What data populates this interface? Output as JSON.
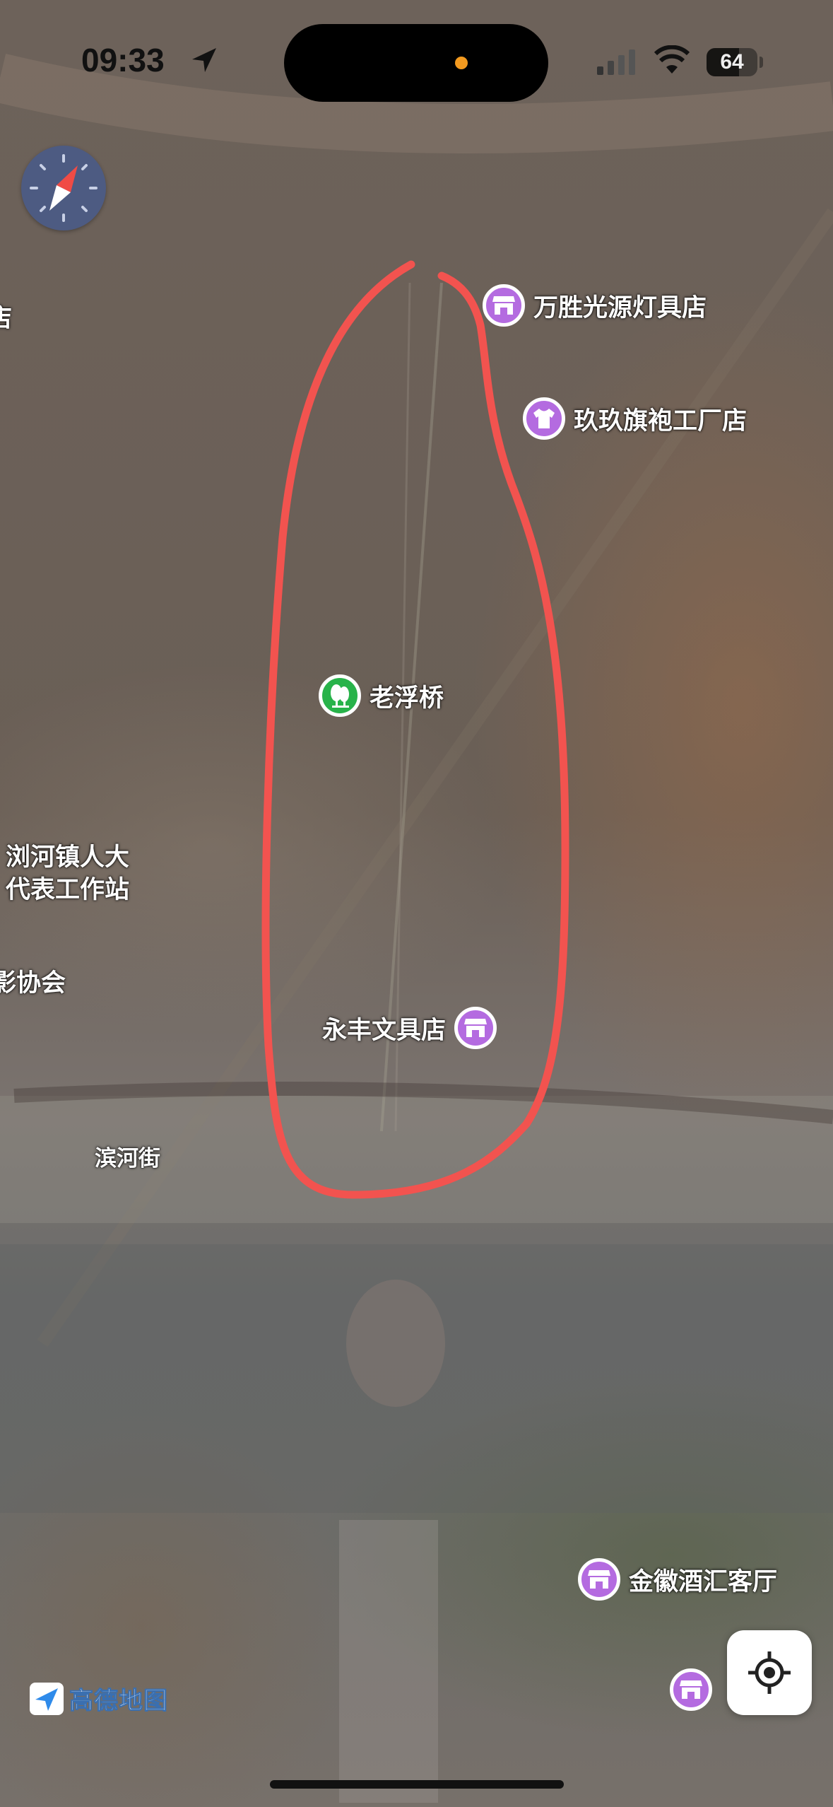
{
  "status_bar": {
    "time": "09:33",
    "battery": "64"
  },
  "map": {
    "compass_icon": "compass-icon",
    "pois": [
      {
        "label": "万胜光源灯具店",
        "icon": "shop-icon",
        "color": "#b46be0"
      },
      {
        "label": "玖玖旗袍工厂店",
        "icon": "clothing-icon",
        "color": "#b46be0"
      },
      {
        "label": "老浮桥",
        "icon": "park-icon",
        "color": "#28b34a"
      },
      {
        "label": "永丰文具店",
        "icon": "shop-icon",
        "color": "#b46be0"
      },
      {
        "label": "金徽酒汇客厅",
        "icon": "shop-icon",
        "color": "#b46be0"
      }
    ],
    "labels": {
      "edge_top": "店",
      "office_line1": "浏河镇人大",
      "office_line2": "代表工作站",
      "association": "影协会",
      "street": "滨河街"
    },
    "annotation_color": "#f2534f"
  },
  "branding": {
    "logo_text": "高德地图"
  },
  "controls": {
    "locate_icon": "locate-icon"
  }
}
